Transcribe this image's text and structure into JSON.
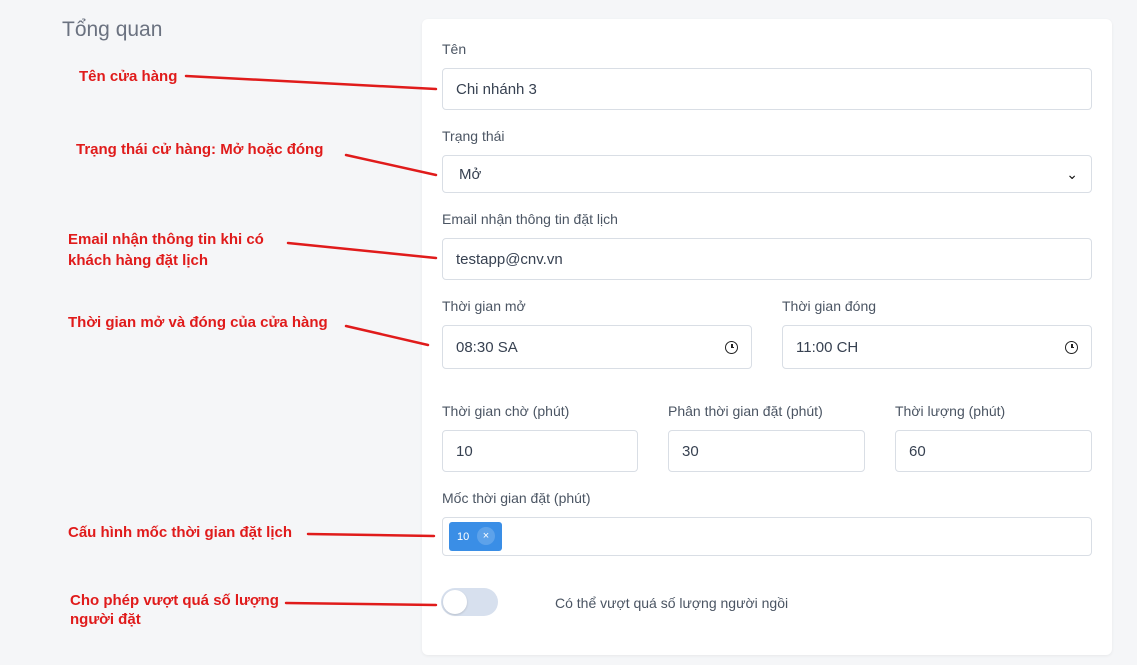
{
  "page": {
    "section_title": "Tổng quan"
  },
  "form": {
    "name": {
      "label": "Tên",
      "value": "Chi nhánh 3"
    },
    "status": {
      "label": "Trạng thái",
      "value": "Mở"
    },
    "email": {
      "label": "Email nhận thông tin đặt lịch",
      "value": "testapp@cnv.vn"
    },
    "open_time": {
      "label": "Thời gian mở",
      "value": "08:30 SA"
    },
    "close_time": {
      "label": "Thời gian đóng",
      "value": "11:00 CH"
    },
    "wait_time": {
      "label": "Thời gian chờ (phút)",
      "value": "10"
    },
    "slot_interval": {
      "label": "Phân thời gian đặt (phút)",
      "value": "30"
    },
    "duration": {
      "label": "Thời lượng (phút)",
      "value": "60"
    },
    "milestones": {
      "label": "Mốc thời gian đặt (phút)",
      "tags": [
        "10"
      ]
    },
    "overbook": {
      "label": "Có thể vượt quá số lượng người ngồi",
      "enabled": false
    }
  },
  "annotations": {
    "store_name": "Tên cửa hàng",
    "store_status": "Trạng thái cử hàng: Mở hoặc đóng",
    "email_line1": "Email nhận thông tin khi có",
    "email_line2": "khách hàng đặt lịch",
    "hours": "Thời gian mở và đóng của cửa hàng",
    "milestones": "Cấu hình mốc thời gian đặt lịch",
    "overbook_line1": "Cho phép vượt quá số lượng",
    "overbook_line2": "người đặt"
  },
  "colors": {
    "annotation": "#e01b1b",
    "tag": "#3a8ee6",
    "toggle_off": "#d7e0ee"
  }
}
